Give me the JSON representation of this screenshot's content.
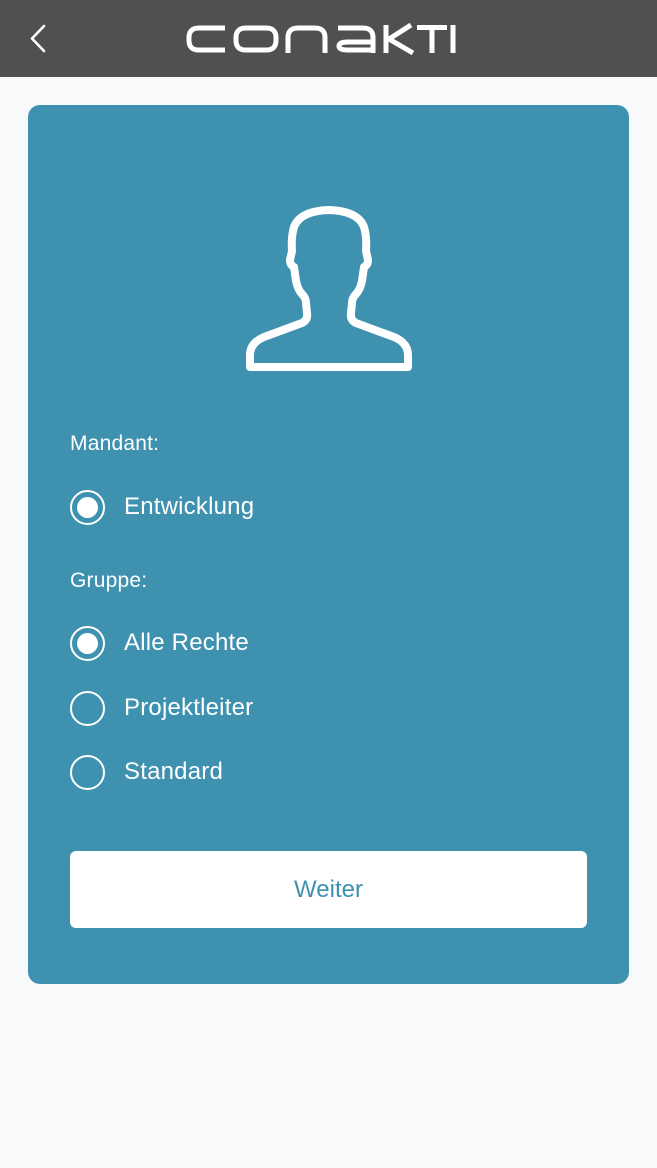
{
  "header": {
    "app_name": "conaktiv",
    "back_icon": "chevron-left-icon"
  },
  "card": {
    "avatar_icon": "user-silhouette-icon",
    "mandant": {
      "label": "Mandant:",
      "options": [
        {
          "label": "Entwicklung",
          "selected": true
        }
      ]
    },
    "gruppe": {
      "label": "Gruppe:",
      "options": [
        {
          "label": "Alle Rechte",
          "selected": true
        },
        {
          "label": "Projektleiter",
          "selected": false
        },
        {
          "label": "Standard",
          "selected": false
        }
      ]
    },
    "submit_label": "Weiter"
  },
  "colors": {
    "header_bg": "#505050",
    "card_bg": "#3e92af",
    "page_bg": "#f8f9fa",
    "button_text": "#3e92af"
  }
}
